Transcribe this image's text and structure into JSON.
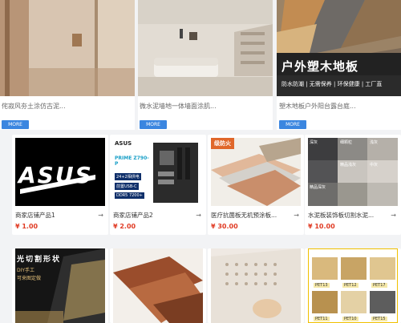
{
  "top_row": [
    {
      "title": "侘寂风夯土涂仿古泥...",
      "more": "MORE"
    },
    {
      "title": "微水泥墙地一体墙面涂肌...",
      "more": "MORE"
    },
    {
      "title": "塑木地板户外阳台露台庭...",
      "more": "MORE",
      "banner": "户外塑木地板",
      "banner_sub": "防水防潮 | 无需保养 | 环保健康 | 工厂直"
    }
  ],
  "products": [
    {
      "title": "商家店铺产品1",
      "price": "¥ 1.00",
      "logo_text": "ASUS",
      "arrow": "→"
    },
    {
      "title": "商家店铺产品2",
      "price": "¥ 2.00",
      "board_brand": "ASUS",
      "board_model": "PRIME Z790-P",
      "board_tags": [
        "24+2相供电",
        "前置USB-C",
        "DDR5 7200+"
      ],
      "arrow": "→"
    },
    {
      "title": "医疗抗菌板无机预涂板...",
      "price": "¥ 30.00",
      "badge": "级防火",
      "arrow": "→"
    },
    {
      "title": "水泥板装饰板切割水泥...",
      "price": "¥ 10.00",
      "swatch_labels": [
        "深灰",
        "细颗粒",
        "浅灰",
        "精品浅灰",
        "中灰",
        "精品深灰"
      ],
      "arrow": "→"
    }
  ],
  "bottom_row": [
    {
      "text": "光切割形状",
      "sub": "DIY手工",
      "sub2": "可来图定做"
    },
    {
      "text": ""
    },
    {
      "text": ""
    },
    {
      "labels": [
        "PET13",
        "PET12",
        "PET17",
        "PET11",
        "PET10",
        "PET15"
      ]
    }
  ]
}
